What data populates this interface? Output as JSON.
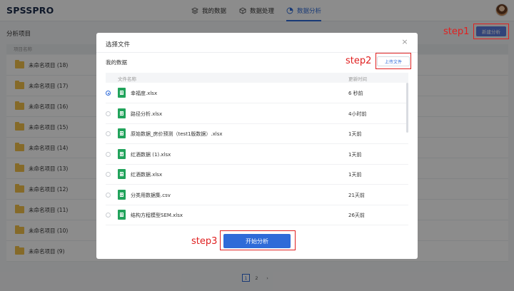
{
  "app": {
    "logo": "SPSSPRO"
  },
  "nav": {
    "items": [
      {
        "label": "我的数据",
        "icon": "layers-icon"
      },
      {
        "label": "数据处理",
        "icon": "cube-icon"
      },
      {
        "label": "数据分析",
        "icon": "pie-chart-icon",
        "active": true
      }
    ]
  },
  "page": {
    "title": "分析项目",
    "new_button": "新建分析",
    "table_header": "项目名称",
    "projects": [
      "未命名项目 (18)",
      "未命名项目 (17)",
      "未命名项目 (16)",
      "未命名项目 (15)",
      "未命名项目 (14)",
      "未命名项目 (13)",
      "未命名项目 (12)",
      "未命名项目 (11)",
      "未命名项目 (10)",
      "未命名项目 (9)"
    ],
    "pager": {
      "pages": [
        "1",
        "2"
      ],
      "current": "1",
      "next": "›"
    }
  },
  "modal": {
    "title": "选择文件",
    "close": "×",
    "section": "我的数据",
    "upload_button": "上传文件",
    "columns": {
      "name": "文件名称",
      "time": "更新时间"
    },
    "files": [
      {
        "name": "幸福度.xlsx",
        "time": "6 秒前",
        "selected": true
      },
      {
        "name": "路径分析.xlsx",
        "time": "4小时前"
      },
      {
        "name": "原始数据_房价预测（test1版数据）.xlsx",
        "time": "1天前"
      },
      {
        "name": "红酒数据 (1).xlsx",
        "time": "1天前"
      },
      {
        "name": "红酒数据.xlsx",
        "time": "1天前"
      },
      {
        "name": "分类用数据集.csv",
        "time": "21天前"
      },
      {
        "name": "结构方程模型SEM.xlsx",
        "time": "26天前"
      }
    ],
    "start_button": "开始分析"
  },
  "annotations": {
    "step1": "step1",
    "step2": "step2",
    "step3": "step3",
    "color": "#e02020"
  }
}
